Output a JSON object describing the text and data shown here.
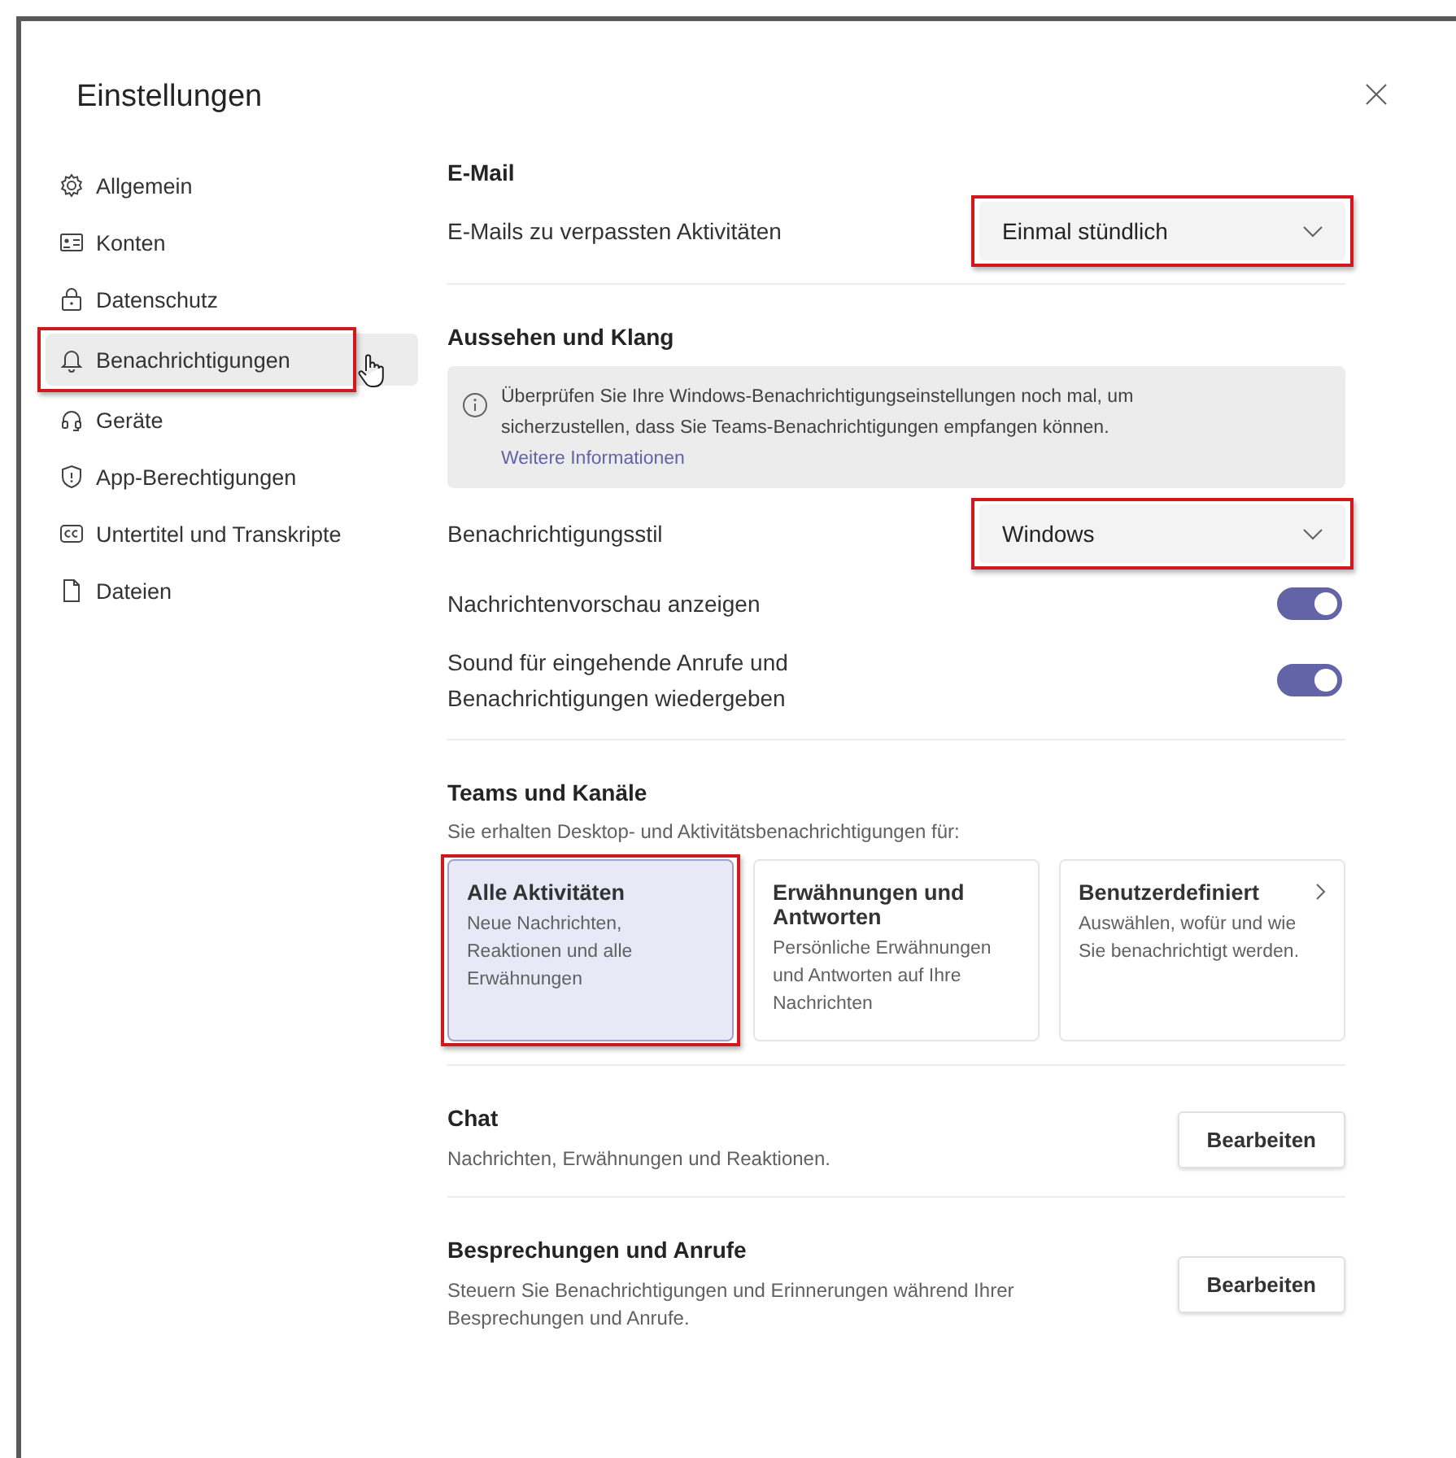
{
  "window": {
    "title": "Einstellungen"
  },
  "sidebar": {
    "items": [
      {
        "label": "Allgemein",
        "selected": false,
        "highlighted": false
      },
      {
        "label": "Konten",
        "selected": false,
        "highlighted": false
      },
      {
        "label": "Datenschutz",
        "selected": false,
        "highlighted": false
      },
      {
        "label": "Benachrichtigungen",
        "selected": true,
        "highlighted": true
      },
      {
        "label": "Geräte",
        "selected": false,
        "highlighted": false
      },
      {
        "label": "App-Berechtigungen",
        "selected": false,
        "highlighted": false
      },
      {
        "label": "Untertitel und Transkripte",
        "selected": false,
        "highlighted": false
      },
      {
        "label": "Dateien",
        "selected": false,
        "highlighted": false
      }
    ]
  },
  "sections": [
    {
      "heading": "E-Mail",
      "rows": [
        {
          "kind": "dropdown",
          "label": "E-Mails zu verpassten Aktivitäten",
          "value": "Einmal stündlich",
          "highlighted": true
        }
      ]
    },
    {
      "heading": "Aussehen und Klang",
      "rows": [
        {
          "kind": "info",
          "text": "Überprüfen Sie Ihre Windows-Benachrichtigungseinstellungen noch mal, um sicherzustellen, dass Sie Teams-Benachrichtigungen empfangen können.",
          "link": "Weitere Informationen"
        },
        {
          "kind": "dropdown",
          "label": "Benachrichtigungsstil",
          "value": "Windows",
          "highlighted": true
        },
        {
          "kind": "toggle",
          "label": "Nachrichtenvorschau anzeigen",
          "on": true
        },
        {
          "kind": "toggle",
          "label": "Sound für eingehende Anrufe und Benachrichtigungen wiedergeben",
          "on": true
        }
      ]
    },
    {
      "heading": "Teams und Kanäle",
      "description": "Sie erhalten Desktop- und Aktivitätsbenachrichtigungen für:",
      "rows": [
        {
          "kind": "cards",
          "cards": [
            {
              "kind": "option",
              "title": "Alle Aktivitäten",
              "description": "Neue Nachrichten, Reaktionen und alle Erwähnungen",
              "selected": true,
              "highlighted": true
            },
            {
              "kind": "option",
              "title": "Erwähnungen und Antworten",
              "description": "Persönliche Erwähnungen und Antworten auf Ihre Nachrichten",
              "selected": false,
              "highlighted": false
            },
            {
              "kind": "submenu",
              "title": "Benutzerdefiniert",
              "description": "Auswählen, wofür und wie Sie benachrichtigt werden.",
              "selected": false,
              "highlighted": false
            }
          ]
        }
      ]
    },
    {
      "heading": "Chat",
      "description": "Nachrichten, Erwähnungen und Reaktionen.",
      "button": "Bearbeiten"
    },
    {
      "heading": "Besprechungen und Anrufe",
      "description": "Steuern Sie Benachrichtigungen und Erinnerungen während Ihrer Besprechungen und Anrufe.",
      "button": "Bearbeiten"
    }
  ]
}
